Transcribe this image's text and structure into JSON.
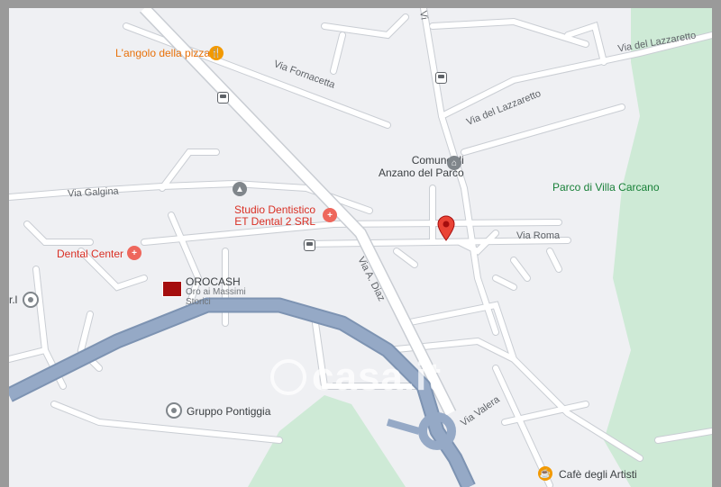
{
  "map": {
    "watermark": "casa.it",
    "colors": {
      "background": "#eff0f3",
      "road": "#ffffff",
      "road_outline": "#c9cdd3",
      "highway": "#8fa4bf",
      "park": "#ceead6",
      "pin": "#ea4335"
    },
    "places": [
      {
        "id": "angolo",
        "name": "L'angolo della pizza",
        "icon": "restaurant-icon"
      },
      {
        "id": "comune",
        "name": "Comune di\nAnzano del Parco",
        "icon": "town-hall-icon"
      },
      {
        "id": "parco",
        "name": "Parco di Villa Carcano",
        "icon": "park"
      },
      {
        "id": "studio",
        "name": "Studio Dentistico\nET Dental 2 SRL",
        "icon": "medical-icon"
      },
      {
        "id": "dental",
        "name": "Dental Center",
        "icon": "medical-icon"
      },
      {
        "id": "orocash",
        "name": "OROCASH",
        "subtitle": "Oro ai Massimi\nStorici",
        "icon": "store-logo-icon"
      },
      {
        "id": "gruppo",
        "name": "Gruppo Pontiggia",
        "icon": "place-icon"
      },
      {
        "id": "cafe",
        "name": "Cafè degli Artisti",
        "icon": "cafe-icon"
      },
      {
        "id": "rl",
        "name": "r.l",
        "icon": "place-icon"
      }
    ],
    "roads": [
      {
        "id": "fornacetta",
        "name": "Via Fornacetta"
      },
      {
        "id": "lazzaretto1",
        "name": "Via del Lazzaretto"
      },
      {
        "id": "lazzaretto2",
        "name": "Via del Lazzaretto"
      },
      {
        "id": "galgina",
        "name": "Via Galgina"
      },
      {
        "id": "roma",
        "name": "Via Roma"
      },
      {
        "id": "diaz",
        "name": "Via A. Diaz"
      },
      {
        "id": "valera",
        "name": "Via Valera"
      },
      {
        "id": "topv",
        "name": "Vi"
      }
    ]
  }
}
